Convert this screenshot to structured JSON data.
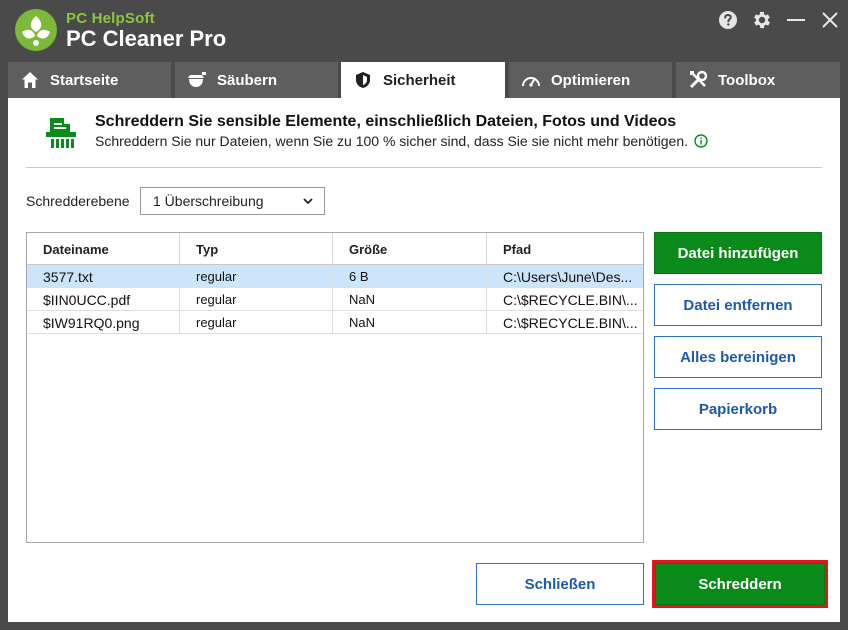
{
  "app": {
    "brand_top": "PC HelpSoft",
    "brand_main": "PC Cleaner Pro",
    "accent_color": "#8dc63f",
    "window_buttons": [
      "help-icon",
      "gear-icon",
      "minimize-icon",
      "close-icon"
    ]
  },
  "tabs": [
    {
      "label": "Startseite",
      "icon": "home-icon"
    },
    {
      "label": "Säubern",
      "icon": "broom-icon"
    },
    {
      "label": "Sicherheit",
      "icon": "shield-icon",
      "active": true
    },
    {
      "label": "Optimieren",
      "icon": "gauge-icon"
    },
    {
      "label": "Toolbox",
      "icon": "tools-icon"
    }
  ],
  "header": {
    "icon": "shredder-icon",
    "title": "Schreddern Sie sensible Elemente, einschließlich Dateien, Fotos und Videos",
    "subtitle": "Schreddern Sie nur Dateien, wenn Sie zu 100 % sicher sind, dass Sie sie nicht mehr benötigen."
  },
  "shred_level": {
    "label": "Schredderebene",
    "selected": "1 Überschreibung"
  },
  "table": {
    "columns": [
      "Dateiname",
      "Typ",
      "Größe",
      "Pfad"
    ],
    "rows": [
      {
        "name": "3577.txt",
        "type": "regular",
        "size": "6 B",
        "path": "C:\\Users\\June\\Des...",
        "selected": true
      },
      {
        "name": "$IIN0UCC.pdf",
        "type": "regular",
        "size": "NaN",
        "path": "C:\\$RECYCLE.BIN\\..."
      },
      {
        "name": "$IW91RQ0.png",
        "type": "regular",
        "size": "NaN",
        "path": "C:\\$RECYCLE.BIN\\..."
      }
    ]
  },
  "side_buttons": {
    "add": "Datei hinzufügen",
    "remove": "Datei entfernen",
    "clear": "Alles bereinigen",
    "recycle": "Papierkorb"
  },
  "footer": {
    "close": "Schließen",
    "shred": "Schreddern"
  },
  "colors": {
    "primary_green": "#0a8a1a",
    "link_blue": "#1f5aa8",
    "highlight_red": "#e0161c",
    "selected_row": "#cce5fb"
  }
}
